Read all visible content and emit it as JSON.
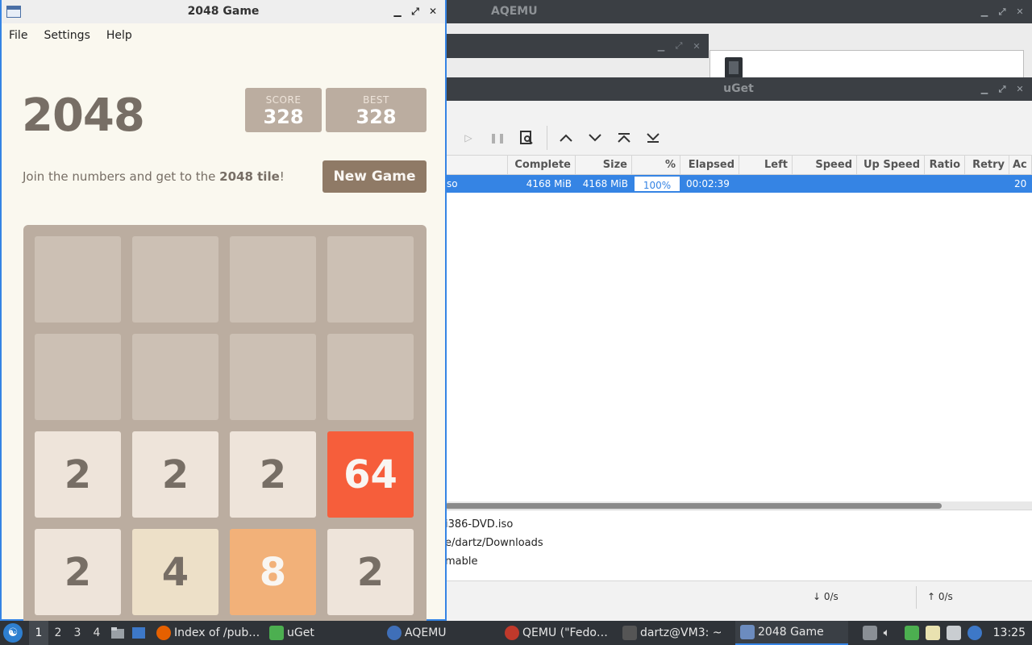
{
  "aqemu": {
    "title": "AQEMU"
  },
  "uget": {
    "title": "uGet",
    "columns": [
      "Complete",
      "Size",
      "%",
      "Elapsed",
      "Left",
      "Speed",
      "Up Speed",
      "Ratio",
      "Retry",
      "Ac"
    ],
    "row": {
      "name": "so",
      "complete": "4168 MiB",
      "size": "4168 MiB",
      "percent": "100%",
      "elapsed": "00:02:39",
      "left": "",
      "speed": "",
      "up_speed": "",
      "ratio": "",
      "retry": "",
      "added": "20"
    },
    "details": {
      "file": "i386-DVD.iso",
      "folder": "e/dartz/Downloads",
      "status": "mable"
    },
    "status": {
      "down": "↓ 0/s",
      "up": "↑ 0/s"
    }
  },
  "game": {
    "window_title": "2048 Game",
    "menu": [
      "File",
      "Settings",
      "Help"
    ],
    "heading": "2048",
    "score_label": "SCORE",
    "score": "328",
    "best_label": "BEST",
    "best": "328",
    "intro_prefix": "Join the numbers and get to the ",
    "intro_bold": "2048 tile",
    "intro_suffix": "!",
    "new_game": "New Game",
    "board": [
      [
        "",
        "",
        "",
        ""
      ],
      [
        "",
        "",
        "",
        ""
      ],
      [
        "2",
        "2",
        "2",
        "64"
      ],
      [
        "2",
        "4",
        "8",
        "2"
      ]
    ]
  },
  "taskbar": {
    "workspaces": [
      "1",
      "2",
      "3",
      "4"
    ],
    "active_workspace": "1",
    "tasks": [
      {
        "label": "Index of /pub…",
        "icon": "firefox-icon",
        "color": "#e66000"
      },
      {
        "label": "uGet",
        "icon": "uget-icon",
        "color": "#4caf50"
      },
      {
        "label": "AQEMU",
        "icon": "aqemu-icon",
        "color": "#3f6fb8"
      },
      {
        "label": "QEMU (\"Fedo…",
        "icon": "qemu-icon",
        "color": "#c0392b"
      },
      {
        "label": "dartz@VM3: ~",
        "icon": "terminal-icon",
        "color": "#555555"
      },
      {
        "label": "2048 Game",
        "icon": "window-icon",
        "color": "#6c8cbf"
      }
    ],
    "clock": "13:25"
  }
}
